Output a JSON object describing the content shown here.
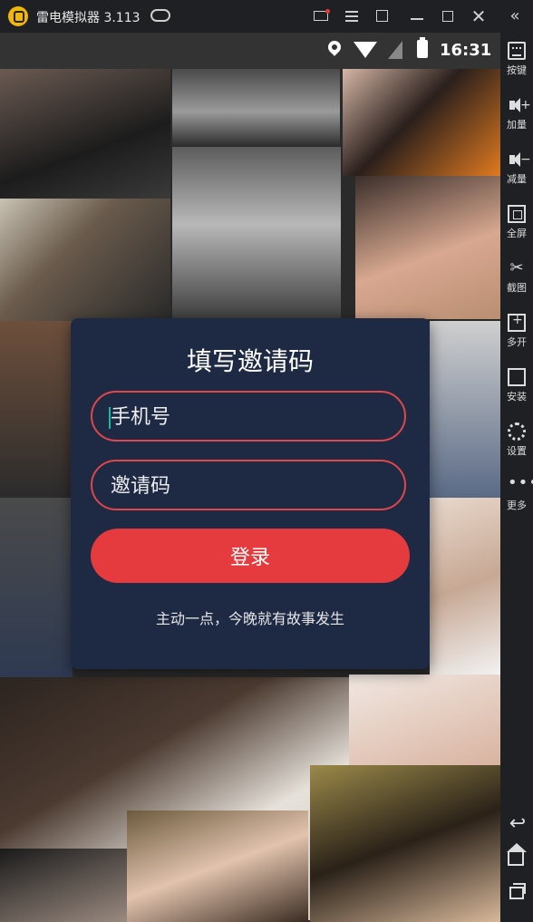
{
  "window": {
    "title": "雷电模拟器 3.113",
    "icons": [
      "logo-icon",
      "gamepad-icon",
      "mail-icon",
      "menu-icon",
      "export-icon",
      "minimize-icon",
      "maximize-icon",
      "close-icon",
      "collapse-icon"
    ]
  },
  "statusbar": {
    "time": "16:31",
    "icons": [
      "location-icon",
      "wifi-icon",
      "signal-icon",
      "battery-icon"
    ]
  },
  "sidebar": {
    "items": [
      {
        "label": "按键",
        "icon": "keyboard-icon"
      },
      {
        "label": "加量",
        "icon": "volume-up-icon"
      },
      {
        "label": "减量",
        "icon": "volume-down-icon"
      },
      {
        "label": "全屏",
        "icon": "fullscreen-icon"
      },
      {
        "label": "截图",
        "icon": "scissors-icon"
      },
      {
        "label": "多开",
        "icon": "multi-instance-icon"
      },
      {
        "label": "安装",
        "icon": "apk-install-icon"
      },
      {
        "label": "设置",
        "icon": "gear-icon"
      },
      {
        "label": "更多",
        "icon": "more-icon"
      }
    ],
    "nav": [
      "back-icon",
      "home-icon",
      "recent-apps-icon"
    ]
  },
  "dialog": {
    "title": "填写邀请码",
    "phone_placeholder": "手机号",
    "invite_placeholder": "邀请码",
    "login_label": "登录",
    "slogan": "主动一点，今晚就有故事发生"
  },
  "colors": {
    "dialog_bg": "#1e2a44",
    "accent_red": "#e53b3e",
    "caret_teal": "#19b9a5",
    "emulator_chrome": "#1f2024"
  }
}
